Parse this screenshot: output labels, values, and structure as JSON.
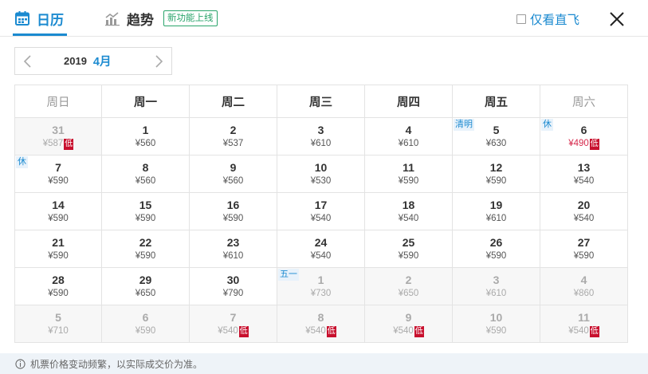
{
  "tabs": {
    "calendar_label": "日历",
    "trend_label": "趋势",
    "new_badge": "新功能上线",
    "active": "calendar"
  },
  "direct_only": {
    "label": "仅看直飞",
    "checked": false
  },
  "month_selector": {
    "year": "2019",
    "month": "4月"
  },
  "weekdays": [
    "周日",
    "周一",
    "周二",
    "周三",
    "周四",
    "周五",
    "周六"
  ],
  "weeks": [
    [
      {
        "day": "31",
        "price": "¥587",
        "low": true,
        "other": true
      },
      {
        "day": "1",
        "price": "¥560"
      },
      {
        "day": "2",
        "price": "¥537"
      },
      {
        "day": "3",
        "price": "¥610"
      },
      {
        "day": "4",
        "price": "¥610"
      },
      {
        "day": "5",
        "price": "¥630",
        "tag": "清明"
      },
      {
        "day": "6",
        "price": "¥490",
        "low": true,
        "tag": "休"
      }
    ],
    [
      {
        "day": "7",
        "price": "¥590",
        "tag": "休"
      },
      {
        "day": "8",
        "price": "¥560"
      },
      {
        "day": "9",
        "price": "¥560"
      },
      {
        "day": "10",
        "price": "¥530"
      },
      {
        "day": "11",
        "price": "¥590"
      },
      {
        "day": "12",
        "price": "¥590"
      },
      {
        "day": "13",
        "price": "¥540"
      }
    ],
    [
      {
        "day": "14",
        "price": "¥590"
      },
      {
        "day": "15",
        "price": "¥590"
      },
      {
        "day": "16",
        "price": "¥590"
      },
      {
        "day": "17",
        "price": "¥540"
      },
      {
        "day": "18",
        "price": "¥540"
      },
      {
        "day": "19",
        "price": "¥610"
      },
      {
        "day": "20",
        "price": "¥540"
      }
    ],
    [
      {
        "day": "21",
        "price": "¥590"
      },
      {
        "day": "22",
        "price": "¥590"
      },
      {
        "day": "23",
        "price": "¥610"
      },
      {
        "day": "24",
        "price": "¥540"
      },
      {
        "day": "25",
        "price": "¥590"
      },
      {
        "day": "26",
        "price": "¥590"
      },
      {
        "day": "27",
        "price": "¥590"
      }
    ],
    [
      {
        "day": "28",
        "price": "¥590"
      },
      {
        "day": "29",
        "price": "¥650"
      },
      {
        "day": "30",
        "price": "¥790"
      },
      {
        "day": "1",
        "price": "¥730",
        "other": true,
        "tag": "五一"
      },
      {
        "day": "2",
        "price": "¥650",
        "other": true
      },
      {
        "day": "3",
        "price": "¥610",
        "other": true
      },
      {
        "day": "4",
        "price": "¥860",
        "other": true
      }
    ],
    [
      {
        "day": "5",
        "price": "¥710",
        "other": true
      },
      {
        "day": "6",
        "price": "¥590",
        "other": true
      },
      {
        "day": "7",
        "price": "¥540",
        "low": true,
        "other": true
      },
      {
        "day": "8",
        "price": "¥540",
        "low": true,
        "other": true
      },
      {
        "day": "9",
        "price": "¥540",
        "low": true,
        "other": true
      },
      {
        "day": "10",
        "price": "¥590",
        "other": true
      },
      {
        "day": "11",
        "price": "¥540",
        "low": true,
        "other": true
      }
    ]
  ],
  "low_badge_label": "低",
  "footer_note": "机票价格变动频繁，以实际成交价为准。",
  "colors": {
    "accent": "#1b8ad0",
    "low_price": "#d6284b",
    "low_badge": "#c8102e",
    "new_badge": "#2aa46b"
  }
}
